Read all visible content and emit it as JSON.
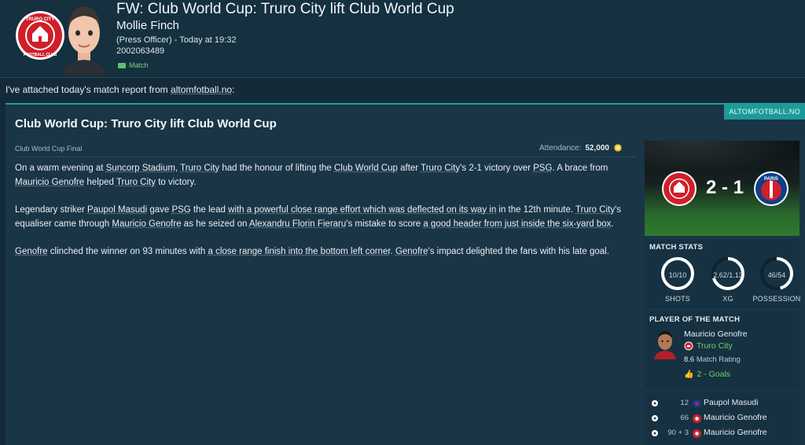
{
  "message": {
    "title": "FW: Club World Cup: Truro City lift Club World Cup",
    "sender_name": "Mollie Finch",
    "sender_role": "(Press Officer) - Today at 19:32",
    "message_id": "2002063489",
    "tag": "Match"
  },
  "intro": {
    "text": "I've attached today's match report from ",
    "source": "altomfotball.no",
    "suffix": ":"
  },
  "article": {
    "source_tab": "ALTOMFOTBALL.NO",
    "title": "Club World Cup: Truro City lift Club World Cup",
    "competition": "Club World Cup Final",
    "attendance_label": "Attendance:",
    "attendance_value": "52,000",
    "p1": {
      "a": "On a warm evening at ",
      "stadium": "Suncorp Stadium",
      "b": ", ",
      "team1": "Truro City",
      "c": " had the honour of lifting the ",
      "comp": "Club World Cup",
      "d": " after ",
      "team2": "Truro City",
      "e": "'s 2-1 victory over ",
      "opp": "PSG",
      "f": ". A brace from ",
      "player": "Mauricio Genofre",
      "g": " helped ",
      "team3": "Truro City",
      "h": " to victory."
    },
    "p2": {
      "a": "Legendary striker ",
      "player1": "Paupol Masudi",
      "b": " gave ",
      "team1": "PSG",
      "c": " the lead ",
      "phrase1": "with a powerful close range effort which was deflected on its way in",
      "d": " in the 12th minute. ",
      "team2": "Truro City",
      "e": "'s equaliser came through ",
      "player2": "Mauricio Genofre",
      "f": " as he seized on ",
      "player3": "Alexandru Florin Fieraru",
      "g": "'s mistake to score ",
      "phrase2": "a good header from just inside the six-yard box",
      "h": "."
    },
    "p3": {
      "player1": "Genofre",
      "a": " clinched the winner on 93 minutes with ",
      "phrase": "a close range finish into the bottom left corner",
      "b": ". ",
      "player2": "Genofre",
      "c": "'s impact delighted the fans with his late goal."
    }
  },
  "scoreboard": {
    "score": "2 - 1",
    "away_badge_text": "PARIS"
  },
  "match_stats": {
    "title": "MATCH STATS",
    "items": [
      {
        "value": "10/10",
        "label": "SHOTS",
        "fill": 1.0
      },
      {
        "value": "2.62/1.13",
        "label": "XG",
        "fill": 0.7
      },
      {
        "value": "46/54",
        "label": "POSSESSION",
        "fill": 0.46
      }
    ]
  },
  "potm": {
    "title": "PLAYER OF THE MATCH",
    "name": "Mauricio Genofre",
    "club": "Truro City",
    "rating_value": "8.6",
    "rating_label": "Match Rating",
    "goals": "2 - Goals"
  },
  "goals": [
    {
      "minute": "12",
      "scorer": "Paupol Masudi",
      "team": "away"
    },
    {
      "minute": "66",
      "scorer": "Mauricio Genofre",
      "team": "home"
    },
    {
      "minute": "90 + 3",
      "scorer": "Mauricio Genofre",
      "team": "home"
    }
  ],
  "colors": {
    "accent": "#1d9a9a",
    "positive": "#6fd36f",
    "home_red": "#d0202b",
    "away_blue": "#0d3f8a"
  }
}
